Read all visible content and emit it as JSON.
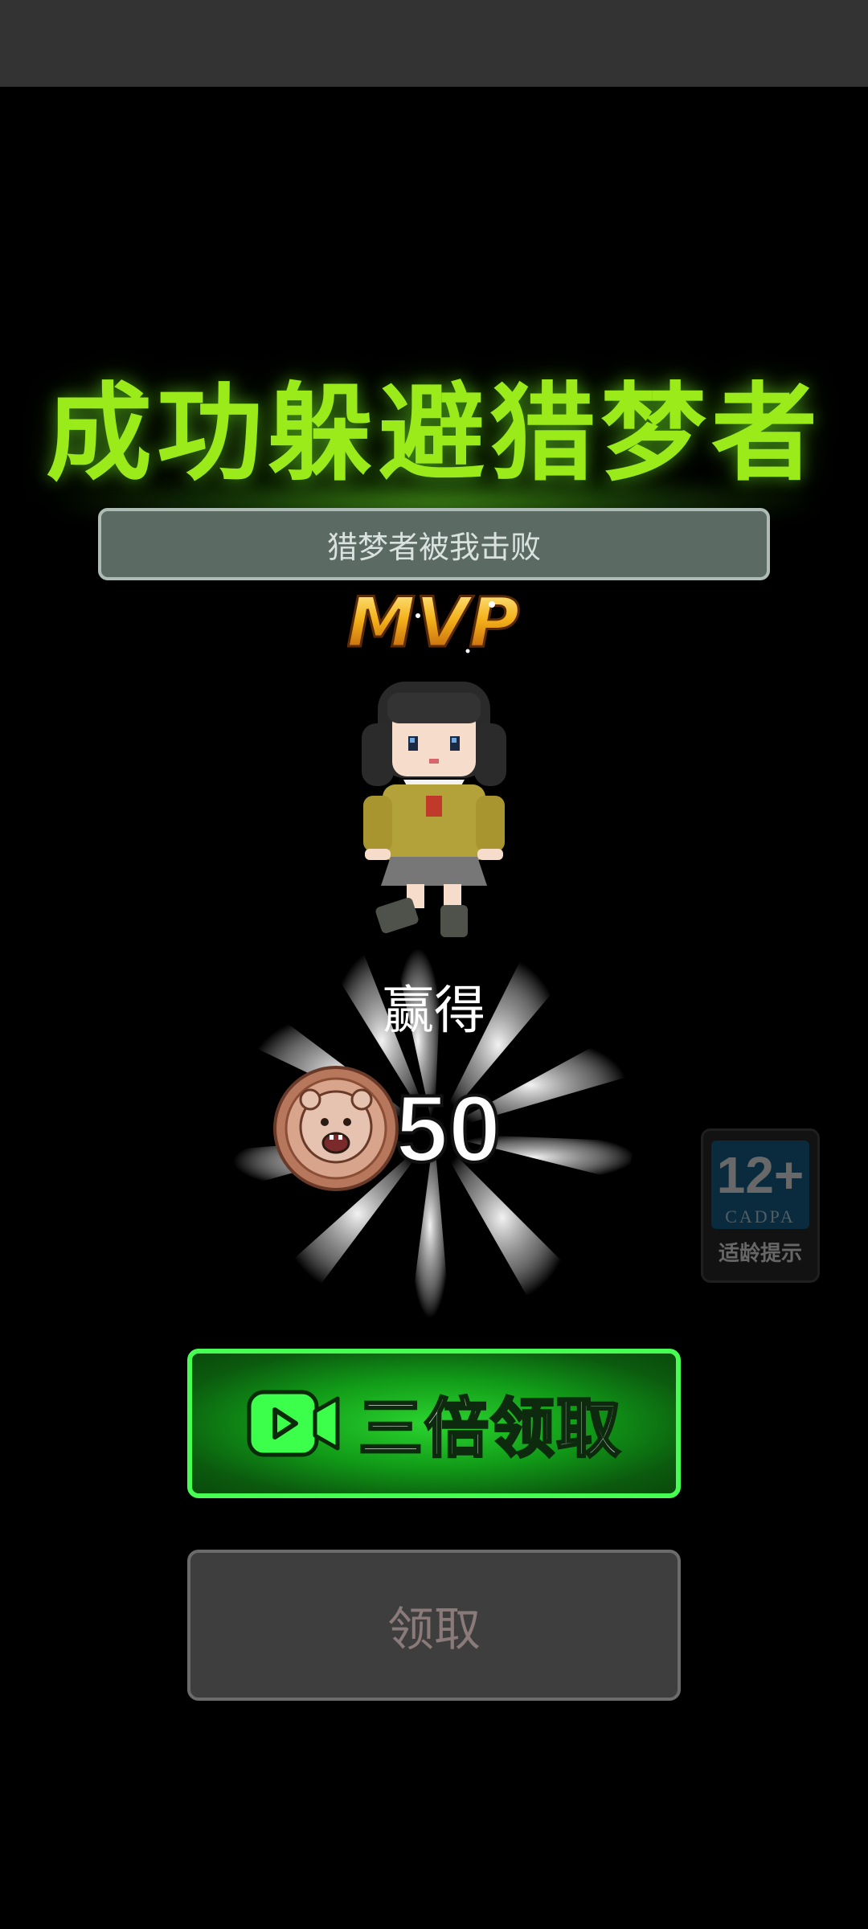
{
  "result": {
    "title": "成功躲避猎梦者",
    "subtitle": "猎梦者被我击败",
    "mvp_text": "MVP"
  },
  "reward": {
    "earned_label": "赢得",
    "amount": "50",
    "currency_icon": "bear-coin-icon"
  },
  "age_rating": {
    "rating": "12+",
    "brand": "CADPA",
    "tip": "适龄提示"
  },
  "buttons": {
    "triple_claim_label": "三倍领取",
    "triple_claim_icon": "video-camera-icon",
    "claim_label": "领取"
  },
  "colors": {
    "title_green": "#9BEA1A",
    "triple_button_border": "#47ff52",
    "triple_button_fill": "#119b18",
    "claim_button_fill": "#3e3e3e",
    "background": "#000000"
  }
}
